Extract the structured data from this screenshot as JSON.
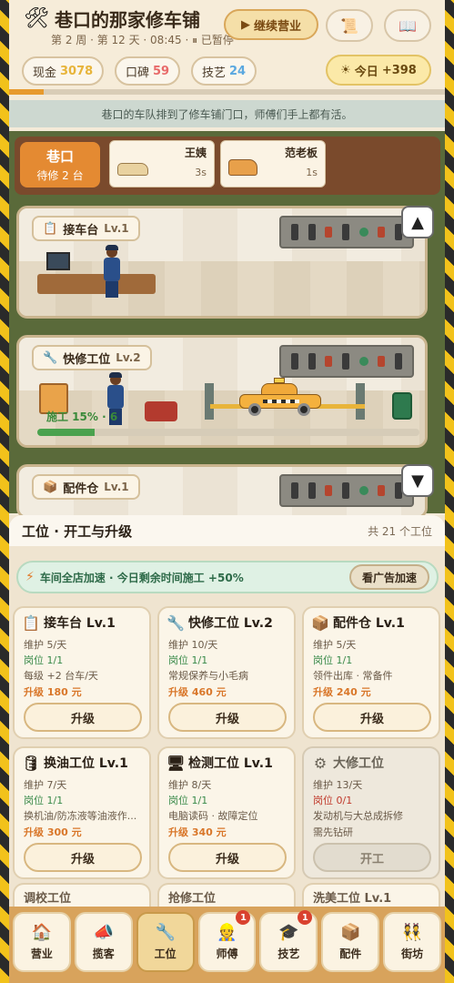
{
  "header": {
    "title_icon": "tools-icon",
    "title": "巷口的那家修车铺",
    "subtitle": "第 2 周 · 第 12 天 · 08:45 · ⏸ 已暂停",
    "continue_label": "继续营业",
    "stats": [
      {
        "label": "现金",
        "value": "3078",
        "color": "#e7b43a"
      },
      {
        "label": "口碑",
        "value": "59",
        "color": "#e86a6a"
      },
      {
        "label": "技艺",
        "value": "24",
        "color": "#5aa8e0"
      }
    ],
    "today_label": "今日",
    "today_value": "+398",
    "day_progress": 0.08
  },
  "notice": "巷口的车队排到了修车铺门口，师傅们手上都有活。",
  "queue": {
    "label": "巷口",
    "waiting": "待修 2 台",
    "cars": [
      {
        "name": "王姨",
        "time": "3s",
        "icon": "sedan-icon"
      },
      {
        "name": "范老板",
        "time": "1s",
        "icon": "van-icon"
      }
    ]
  },
  "scene_stations": [
    {
      "name": "接车台",
      "level": "Lv.1",
      "icon": "clipboard-icon"
    },
    {
      "name": "快修工位",
      "level": "Lv.2",
      "icon": "wrench-icon",
      "work_label": "施工 15% · 6",
      "progress": 0.15
    },
    {
      "name": "配件仓",
      "level": "Lv.1",
      "icon": "box-icon"
    }
  ],
  "panel": {
    "title": "工位 · 开工与升级",
    "count": "共 21 个工位",
    "boost_text": "车间全店加速 · 今日剩余时间施工 +50%",
    "boost_button": "看广告加速"
  },
  "cards": [
    {
      "title": "接车台 Lv.1",
      "icon": "clipboard-icon",
      "upkeep": "维护 5/天",
      "slots": "岗位 1/1",
      "desc": "每级 +2 台车/天",
      "cost": "升级 180 元",
      "button": "升级"
    },
    {
      "title": "快修工位 Lv.2",
      "icon": "wrench-icon",
      "upkeep": "维护 10/天",
      "slots": "岗位 1/1",
      "desc": "常规保养与小毛病",
      "cost": "升级 460 元",
      "button": "升级"
    },
    {
      "title": "配件仓 Lv.1",
      "icon": "box-icon",
      "upkeep": "维护 5/天",
      "slots": "岗位 1/1",
      "desc": "领件出库 · 常备件",
      "cost": "升级 240 元",
      "button": "升级"
    },
    {
      "title": "换油工位 Lv.1",
      "icon": "oil-barrel-icon",
      "upkeep": "维护 7/天",
      "slots": "岗位 1/1",
      "desc": "换机油/防冻液等油液作...",
      "cost": "升级 300 元",
      "button": "升级"
    },
    {
      "title": "检测工位 Lv.1",
      "icon": "computer-icon",
      "upkeep": "维护 8/天",
      "slots": "岗位 1/1",
      "desc": "电脑读码 · 故障定位",
      "cost": "升级 340 元",
      "button": "升级"
    },
    {
      "title": "大修工位",
      "icon": "gear-icon",
      "upkeep": "维护 13/天",
      "slots": "岗位 0/1",
      "desc": "发动机与大总成拆修",
      "cost": "需先钻研",
      "button": "开工"
    }
  ],
  "peek_cards": [
    "调校工位",
    "抢修工位",
    "洗美工位 Lv.1"
  ],
  "nav": [
    {
      "label": "营业",
      "icon": "house-icon",
      "badge": ""
    },
    {
      "label": "揽客",
      "icon": "megaphone-icon",
      "badge": ""
    },
    {
      "label": "工位",
      "icon": "wrench-icon",
      "badge": ""
    },
    {
      "label": "师傅",
      "icon": "worker-icon",
      "badge": "1"
    },
    {
      "label": "技艺",
      "icon": "graduation-cap-icon",
      "badge": "1"
    },
    {
      "label": "配件",
      "icon": "box-icon",
      "badge": ""
    },
    {
      "label": "街坊",
      "icon": "neighbors-icon",
      "badge": ""
    }
  ]
}
